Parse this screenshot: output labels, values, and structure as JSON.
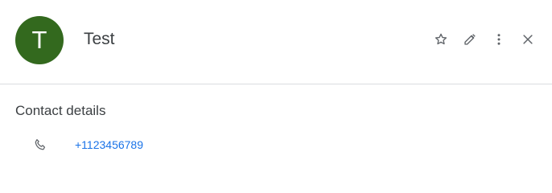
{
  "contact": {
    "avatar_initial": "T",
    "avatar_color": "#33691e",
    "name": "Test"
  },
  "actions": {
    "icons": [
      "star-outline-icon",
      "pencil-icon",
      "more-vert-icon",
      "close-icon"
    ]
  },
  "details": {
    "section_title": "Contact details",
    "phone_icon": "phone-icon",
    "phone": "+1123456789"
  },
  "colors": {
    "link": "#1a73e8",
    "text": "#3c4043",
    "icon": "#5f6368",
    "divider": "#dadce0"
  }
}
